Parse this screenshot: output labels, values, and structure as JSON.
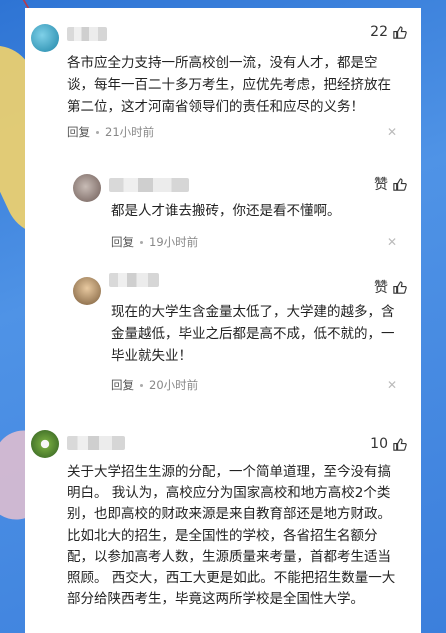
{
  "comments": [
    {
      "likes": "22",
      "text": "各市应全力支持一所高校创一流，没有人才，都是空谈，每年一百二十多万考生，应优先考虑，把经挤放在第二位，这才河南省领导们的责任和应尽的义务！",
      "reply": "回复",
      "time": "21小时前"
    },
    {
      "likes": "赞",
      "text": "都是人才谁去搬砖，你还是看不懂啊。",
      "reply": "回复",
      "time": "19小时前"
    },
    {
      "likes": "赞",
      "text": "现在的大学生含金量太低了，大学建的越多，含金量越低，毕业之后都是高不成，低不就的，一毕业就失业！",
      "reply": "回复",
      "time": "20小时前"
    },
    {
      "likes": "10",
      "text": "关于大学招生生源的分配，一个简单道理，至今没有搞明白。 我认为，高校应分为国家高校和地方高校2个类别，也即高校的财政来源是来自教育部还是地方财政。 比如北大的招生，是全国性的学校，各省招生名额分配，以参加高考人数，生源质量来考量，首都考生适当照顾。 西交大，西工大更是如此。不能把招生数量一大部分给陕西考生，毕竟这两所学校是全国性大学。"
    }
  ],
  "colors": {
    "background": "#3c7fdc",
    "panel": "#ffffff",
    "text": "#222222",
    "meta": "#888888"
  },
  "icons": [
    "thumb-up-icon",
    "close-icon"
  ]
}
